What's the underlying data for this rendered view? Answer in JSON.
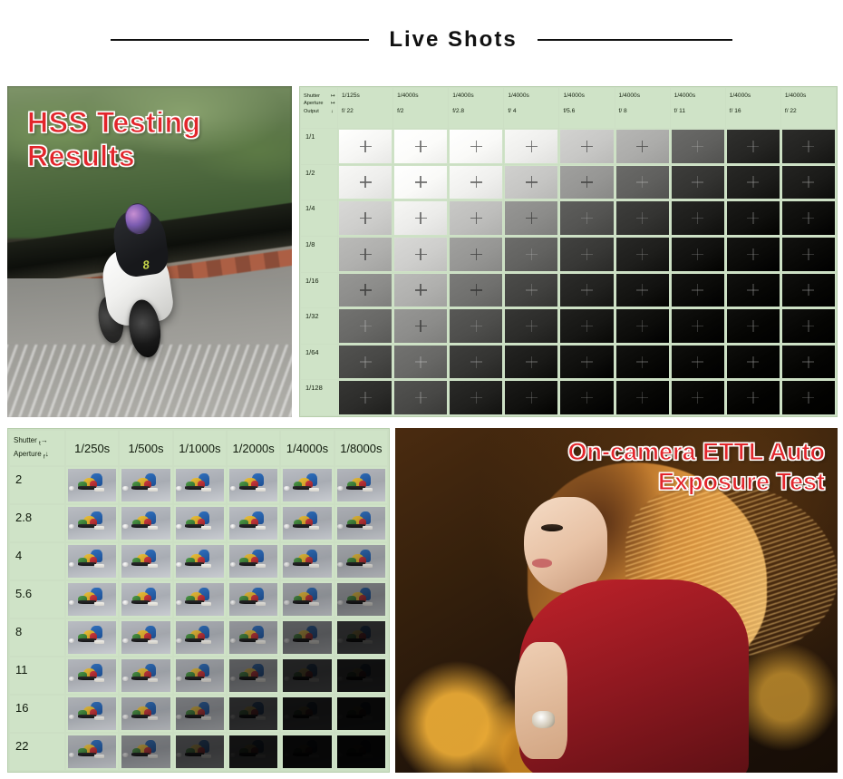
{
  "page": {
    "title": "Live Shots"
  },
  "hss_section": {
    "photo": {
      "name": "motorcycle-racing-photo",
      "overlay_label": "HSS Testing Results"
    },
    "table": {
      "corner": {
        "line1_label": "Shutter",
        "line1_arrow": "↦",
        "line2_label": "Aperture",
        "line2_arrow": "↦",
        "line3_label": "Output",
        "line3_arrow": "↓"
      },
      "columns": [
        {
          "shutter": "1/125s",
          "aperture": "f/ 22"
        },
        {
          "shutter": "1/4000s",
          "aperture": "f/2"
        },
        {
          "shutter": "1/4000s",
          "aperture": "f/2.8"
        },
        {
          "shutter": "1/4000s",
          "aperture": "f/ 4"
        },
        {
          "shutter": "1/4000s",
          "aperture": "f/5.6"
        },
        {
          "shutter": "1/4000s",
          "aperture": "f/ 8"
        },
        {
          "shutter": "1/4000s",
          "aperture": "f/ 11"
        },
        {
          "shutter": "1/4000s",
          "aperture": "f/ 16"
        },
        {
          "shutter": "1/4000s",
          "aperture": "f/ 22"
        }
      ],
      "rows": [
        "1/1",
        "1/2",
        "1/4",
        "1/8",
        "1/16",
        "1/32",
        "1/64",
        "1/128"
      ],
      "cell_marker": "plus-crosshair",
      "luminance_grid": [
        [
          246,
          252,
          250,
          238,
          200,
          172,
          96,
          38,
          34
        ],
        [
          238,
          250,
          240,
          198,
          150,
          96,
          52,
          30,
          26
        ],
        [
          206,
          236,
          190,
          140,
          84,
          52,
          28,
          16,
          12
        ],
        [
          176,
          206,
          150,
          98,
          56,
          30,
          16,
          10,
          8
        ],
        [
          140,
          176,
          112,
          66,
          34,
          18,
          10,
          7,
          6
        ],
        [
          104,
          140,
          78,
          44,
          22,
          12,
          7,
          5,
          5
        ],
        [
          72,
          104,
          52,
          26,
          14,
          8,
          5,
          4,
          4
        ],
        [
          44,
          72,
          32,
          16,
          9,
          6,
          4,
          3,
          3
        ]
      ]
    }
  },
  "ettl_section": {
    "table": {
      "corner": {
        "line1_label": "Shutter",
        "line1_sub": "t",
        "line1_arrow": "→",
        "line2_label": "Aperture",
        "line2_sub": "f",
        "line2_arrow": "↓"
      },
      "columns": [
        "1/250s",
        "1/500s",
        "1/1000s",
        "1/2000s",
        "1/4000s",
        "1/8000s"
      ],
      "rows": [
        "2",
        "2.8",
        "4",
        "5.6",
        "8",
        "11",
        "16",
        "22"
      ],
      "thumbnail_subject": "colorful-toy-object",
      "brightness_grid": [
        [
          1.0,
          1.0,
          1.0,
          1.0,
          1.0,
          0.98
        ],
        [
          1.0,
          1.0,
          1.0,
          1.0,
          0.98,
          0.95
        ],
        [
          1.0,
          1.0,
          1.0,
          0.98,
          0.95,
          0.9
        ],
        [
          1.0,
          1.0,
          0.98,
          0.95,
          0.88,
          0.74
        ],
        [
          1.0,
          0.98,
          0.94,
          0.86,
          0.62,
          0.34
        ],
        [
          0.98,
          0.95,
          0.88,
          0.62,
          0.3,
          0.16
        ],
        [
          0.96,
          0.9,
          0.74,
          0.34,
          0.16,
          0.09
        ],
        [
          0.92,
          0.76,
          0.46,
          0.18,
          0.08,
          0.05
        ]
      ]
    },
    "photo": {
      "name": "portrait-golden-bokeh-photo",
      "overlay_label": "On-camera  ETTL Auto\nExposure Test"
    }
  },
  "colors": {
    "table_green": "#cfe3c7",
    "table_border": "#b7ceac",
    "overlay_red": "#e2252b",
    "title_black": "#111111",
    "page_background": "#ffffff"
  }
}
